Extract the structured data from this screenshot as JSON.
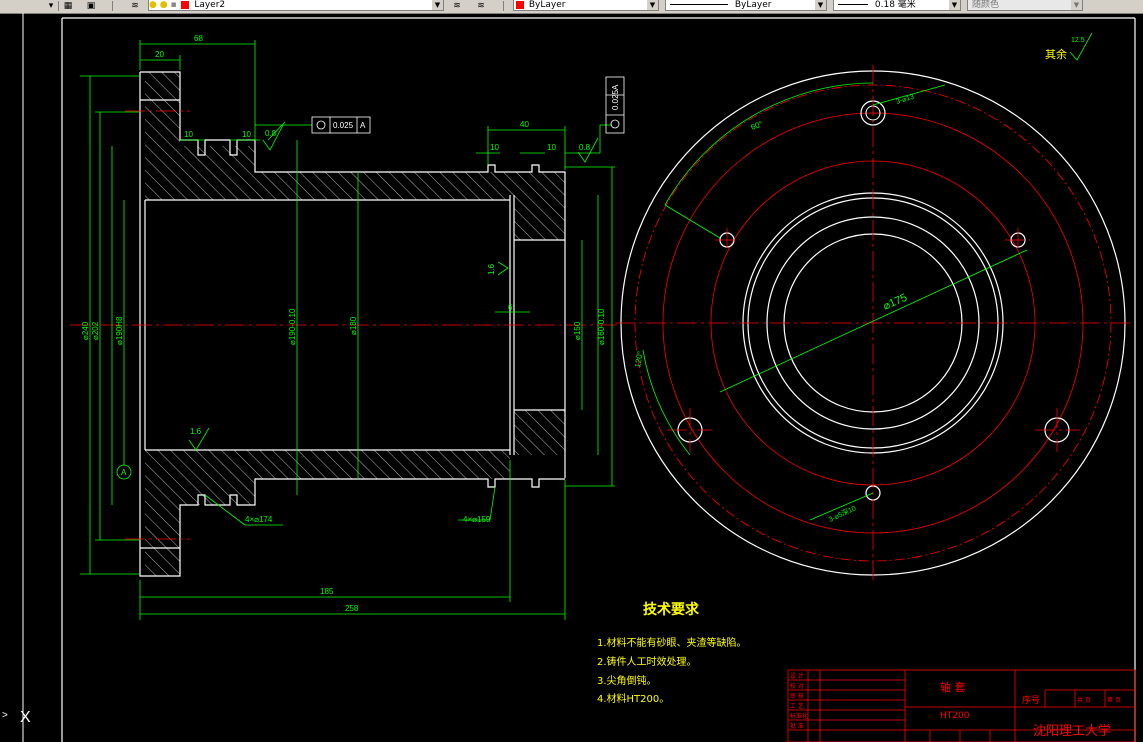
{
  "toolbar": {
    "layer_name": "Layer2",
    "color_name": "ByLayer",
    "linetype_name": "ByLayer",
    "lineweight_value": "0.18 毫米",
    "plotstyle_name": "随颜色",
    "layer_color": "#ff0000",
    "color_swatch": "#ff0000"
  },
  "drawing": {
    "tech_title": "技术要求",
    "tech_items": [
      "1.材料不能有砂眼、夹渣等缺陷。",
      "2.铸件人工时效处理。",
      "3.尖角倒钝。",
      "4.材料HT200。"
    ],
    "roughness_remaining": "其余",
    "roughness_remaining_value": "12.5",
    "diameter_label": "⌀175",
    "angle_label_120": "120°",
    "angle_label_60": "60°",
    "hole_note_top": "3-⌀13",
    "hole_note_bottom": "3-⌀5深10",
    "dim_68": "68",
    "dim_20": "20",
    "dim_10a": "10",
    "dim_10b": "10",
    "dim_40": "40",
    "dim_10c": "10",
    "dim_10d": "10",
    "dim_185": "185",
    "dim_258": "258",
    "dim_groove_left": "4×⌀174",
    "dim_groove_right": "4×⌀159",
    "rough_08_left": "0.8",
    "rough_08_right": "0.8",
    "rough_16_left": "1.6",
    "rough_16_mid": "1.6",
    "tol_flatness": "0.025",
    "tol_flatness_datum": "A",
    "tol_vertical": "0.025",
    "tol_vertical_datum": "A",
    "datum_label": "A",
    "vdim_240": "⌀240",
    "vdim_202": "⌀202",
    "vdim_fit": "⌀190H8",
    "vdim_mid": "⌀190-0.10",
    "vdim_180": "⌀180",
    "vdim_bore": "⌀150",
    "vdim_right": "⌀160-0.10",
    "sym_6": "6"
  },
  "title_block": {
    "part_name": "轴 套",
    "material": "HT200",
    "school": "沈阳理工大学",
    "seq": "序号",
    "rows": [
      "设 计",
      "校 对",
      "审 核",
      "工 艺",
      "标准化",
      "批 准"
    ],
    "sheet_labels": [
      "共 页",
      "第 页"
    ]
  },
  "cmdline": {
    "prompt": ">",
    "axis_glyph": "X"
  },
  "colors": {
    "background": "#000000",
    "outline": "#ffffff",
    "dimension": "#00ff00",
    "centerline": "#ff0000",
    "hatch": "#ffffff",
    "yellow_text": "#ffff00",
    "cyan": "#00ffff"
  }
}
